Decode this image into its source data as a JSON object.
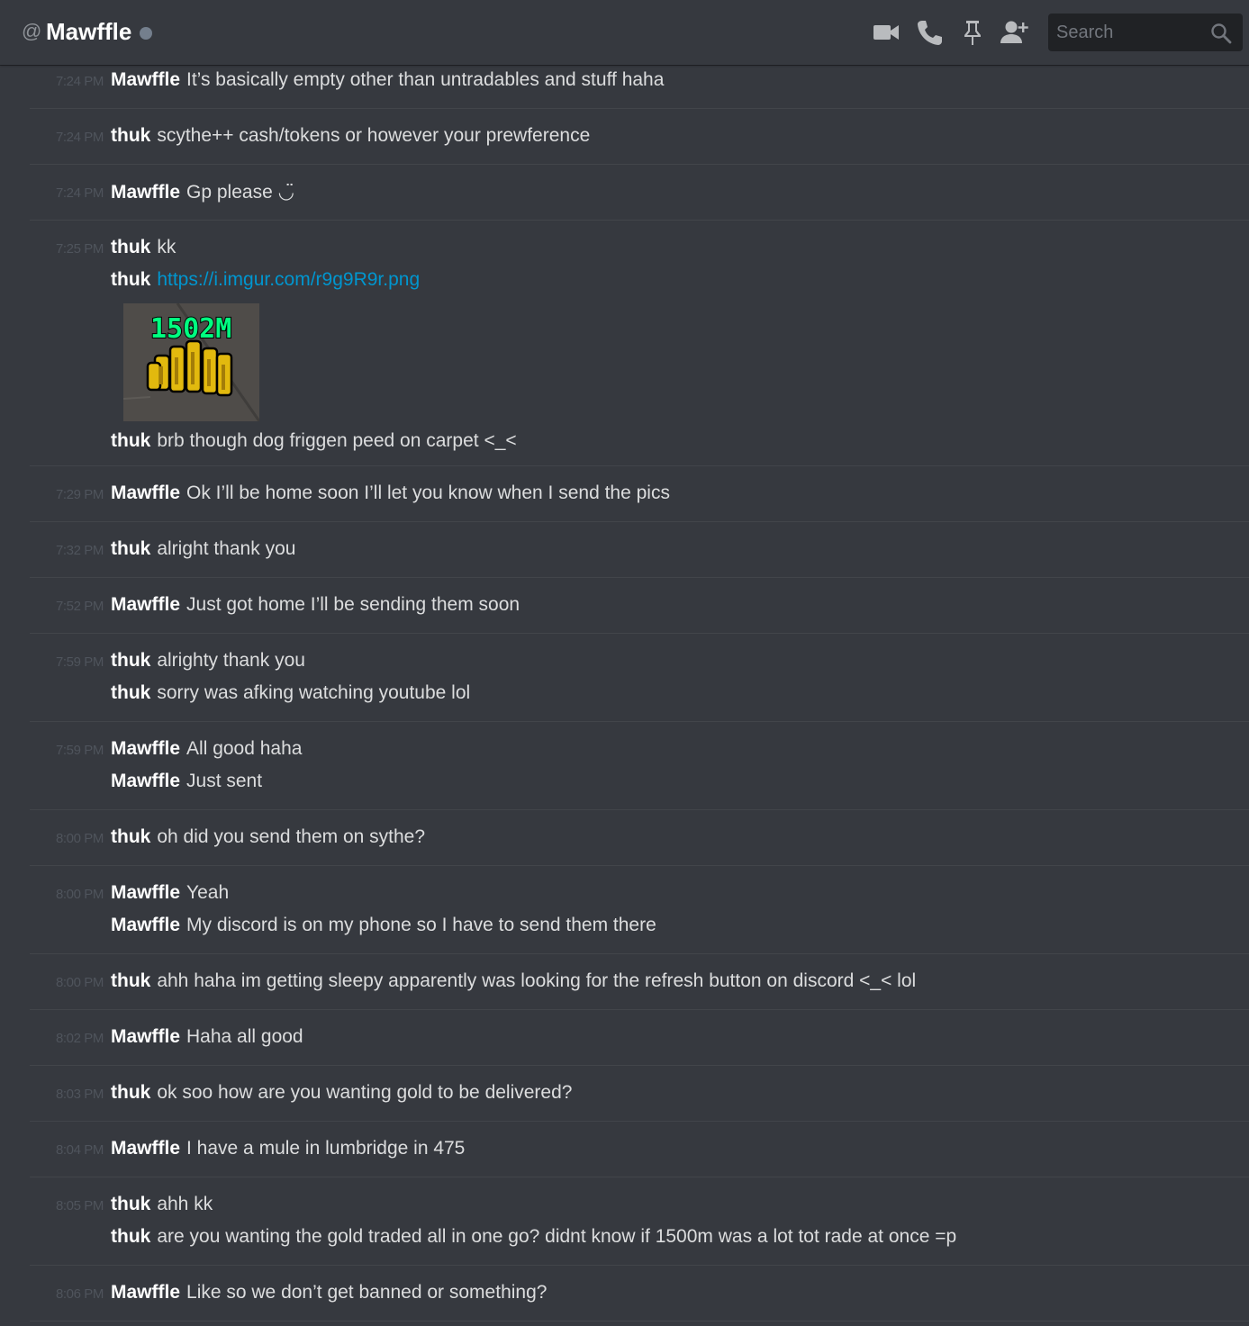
{
  "header": {
    "at_symbol": "@",
    "title": "Mawffle",
    "status_color": "#747f8d",
    "icons": [
      "video-call-icon",
      "voice-call-icon",
      "pin-icon",
      "add-friend-icon"
    ],
    "search_placeholder": "Search"
  },
  "colors": {
    "background": "#36393f",
    "username": "#ffffff",
    "text": "#dcddde",
    "timestamp": "#4f545c",
    "link": "#0096cf",
    "divider": "#42454a"
  },
  "messages": [
    {
      "time": "7:24 PM",
      "lines": [
        {
          "author": "Mawffle",
          "text": "It’s basically empty other than untradables and stuff haha"
        }
      ]
    },
    {
      "time": "7:24 PM",
      "lines": [
        {
          "author": "thuk",
          "text": "scythe++ cash/tokens or however your prewference"
        }
      ]
    },
    {
      "time": "7:24 PM",
      "lines": [
        {
          "author": "Mawffle",
          "text": "Gp please ◡̈"
        }
      ]
    },
    {
      "time": "7:25 PM",
      "lines": [
        {
          "author": "thuk",
          "text": "kk"
        },
        {
          "author": "thuk",
          "link": "https://i.imgur.com/r9g9R9r.png",
          "embed_caption": "1502M"
        },
        {
          "author": "thuk",
          "text": "brb though dog friggen peed on carpet <_<"
        }
      ]
    },
    {
      "time": "7:29 PM",
      "lines": [
        {
          "author": "Mawffle",
          "text": "Ok I’ll be home soon I’ll let you know when I send the pics"
        }
      ]
    },
    {
      "time": "7:32 PM",
      "lines": [
        {
          "author": "thuk",
          "text": "alright thank you"
        }
      ]
    },
    {
      "time": "7:52 PM",
      "lines": [
        {
          "author": "Mawffle",
          "text": "Just got home I’ll be sending them soon"
        }
      ]
    },
    {
      "time": "7:59 PM",
      "lines": [
        {
          "author": "thuk",
          "text": "alrighty thank you"
        },
        {
          "author": "thuk",
          "text": "sorry was afking watching youtube lol"
        }
      ]
    },
    {
      "time": "7:59 PM",
      "lines": [
        {
          "author": "Mawffle",
          "text": "All good haha"
        },
        {
          "author": "Mawffle",
          "text": "Just sent"
        }
      ]
    },
    {
      "time": "8:00 PM",
      "lines": [
        {
          "author": "thuk",
          "text": "oh did you send them on sythe?"
        }
      ]
    },
    {
      "time": "8:00 PM",
      "lines": [
        {
          "author": "Mawffle",
          "text": "Yeah"
        },
        {
          "author": "Mawffle",
          "text": "My discord is on my phone so I have to send them there"
        }
      ]
    },
    {
      "time": "8:00 PM",
      "lines": [
        {
          "author": "thuk",
          "text": "ahh haha im getting sleepy apparently was looking for the refresh button on discord <_< lol"
        }
      ]
    },
    {
      "time": "8:02 PM",
      "lines": [
        {
          "author": "Mawffle",
          "text": "Haha all good"
        }
      ]
    },
    {
      "time": "8:03 PM",
      "lines": [
        {
          "author": "thuk",
          "text": "ok soo how are you wanting gold to be delivered?"
        }
      ]
    },
    {
      "time": "8:04 PM",
      "lines": [
        {
          "author": "Mawffle",
          "text": "I have a mule in lumbridge in 475"
        }
      ]
    },
    {
      "time": "8:05 PM",
      "lines": [
        {
          "author": "thuk",
          "text": "ahh kk"
        },
        {
          "author": "thuk",
          "text": "are you wanting the gold traded all in one go? didnt know if 1500m was a lot tot rade at once =p"
        }
      ]
    },
    {
      "time": "8:06 PM",
      "lines": [
        {
          "author": "Mawffle",
          "text": "Like so we don’t get banned or something?"
        }
      ]
    }
  ]
}
